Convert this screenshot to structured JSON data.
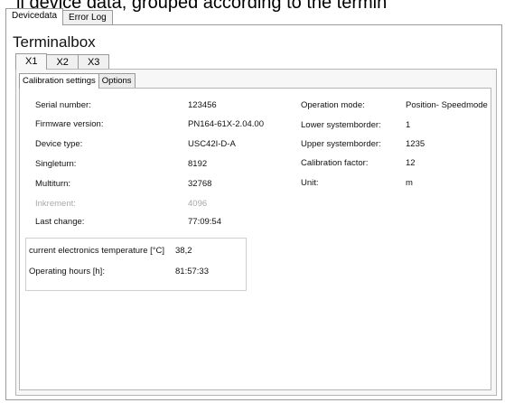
{
  "caption": "ll device data, grouped according to the termin",
  "top_tabs": [
    {
      "label": "Devicedata"
    },
    {
      "label": "Error Log"
    }
  ],
  "title": "Terminalbox",
  "terminal_tabs": [
    {
      "label": "X1"
    },
    {
      "label": "X2"
    },
    {
      "label": "X3"
    }
  ],
  "inner_tabs": [
    {
      "label": "Calibration settings"
    },
    {
      "label": "Options"
    }
  ],
  "left_fields": [
    {
      "label": "Serial number:",
      "value": "123456"
    },
    {
      "label": "Firmware version:",
      "value": "PN164-61X-2.04.00"
    },
    {
      "label": "Device type:",
      "value": "USC42I-D-A"
    },
    {
      "label": "Singleturn:",
      "value": "8192"
    },
    {
      "label": "Multiturn:",
      "value": "32768"
    },
    {
      "label": "Inkrement:",
      "value": "4096"
    },
    {
      "label": "Last change:",
      "value": "77:09:54"
    }
  ],
  "right_fields": [
    {
      "label": "Operation mode:",
      "value": "Position- Speedmode"
    },
    {
      "label": "Lower  systemborder:",
      "value": "1"
    },
    {
      "label": "Upper systemborder:",
      "value": "1235"
    },
    {
      "label": "Calibration factor:",
      "value": "12"
    },
    {
      "label": "Unit:",
      "value": "m"
    }
  ],
  "status": {
    "temperature_label": "current electronics temperature [°C]",
    "temperature_value": "38,2",
    "hours_label": "Operating hours [h]:",
    "hours_value": "81:57:33"
  }
}
